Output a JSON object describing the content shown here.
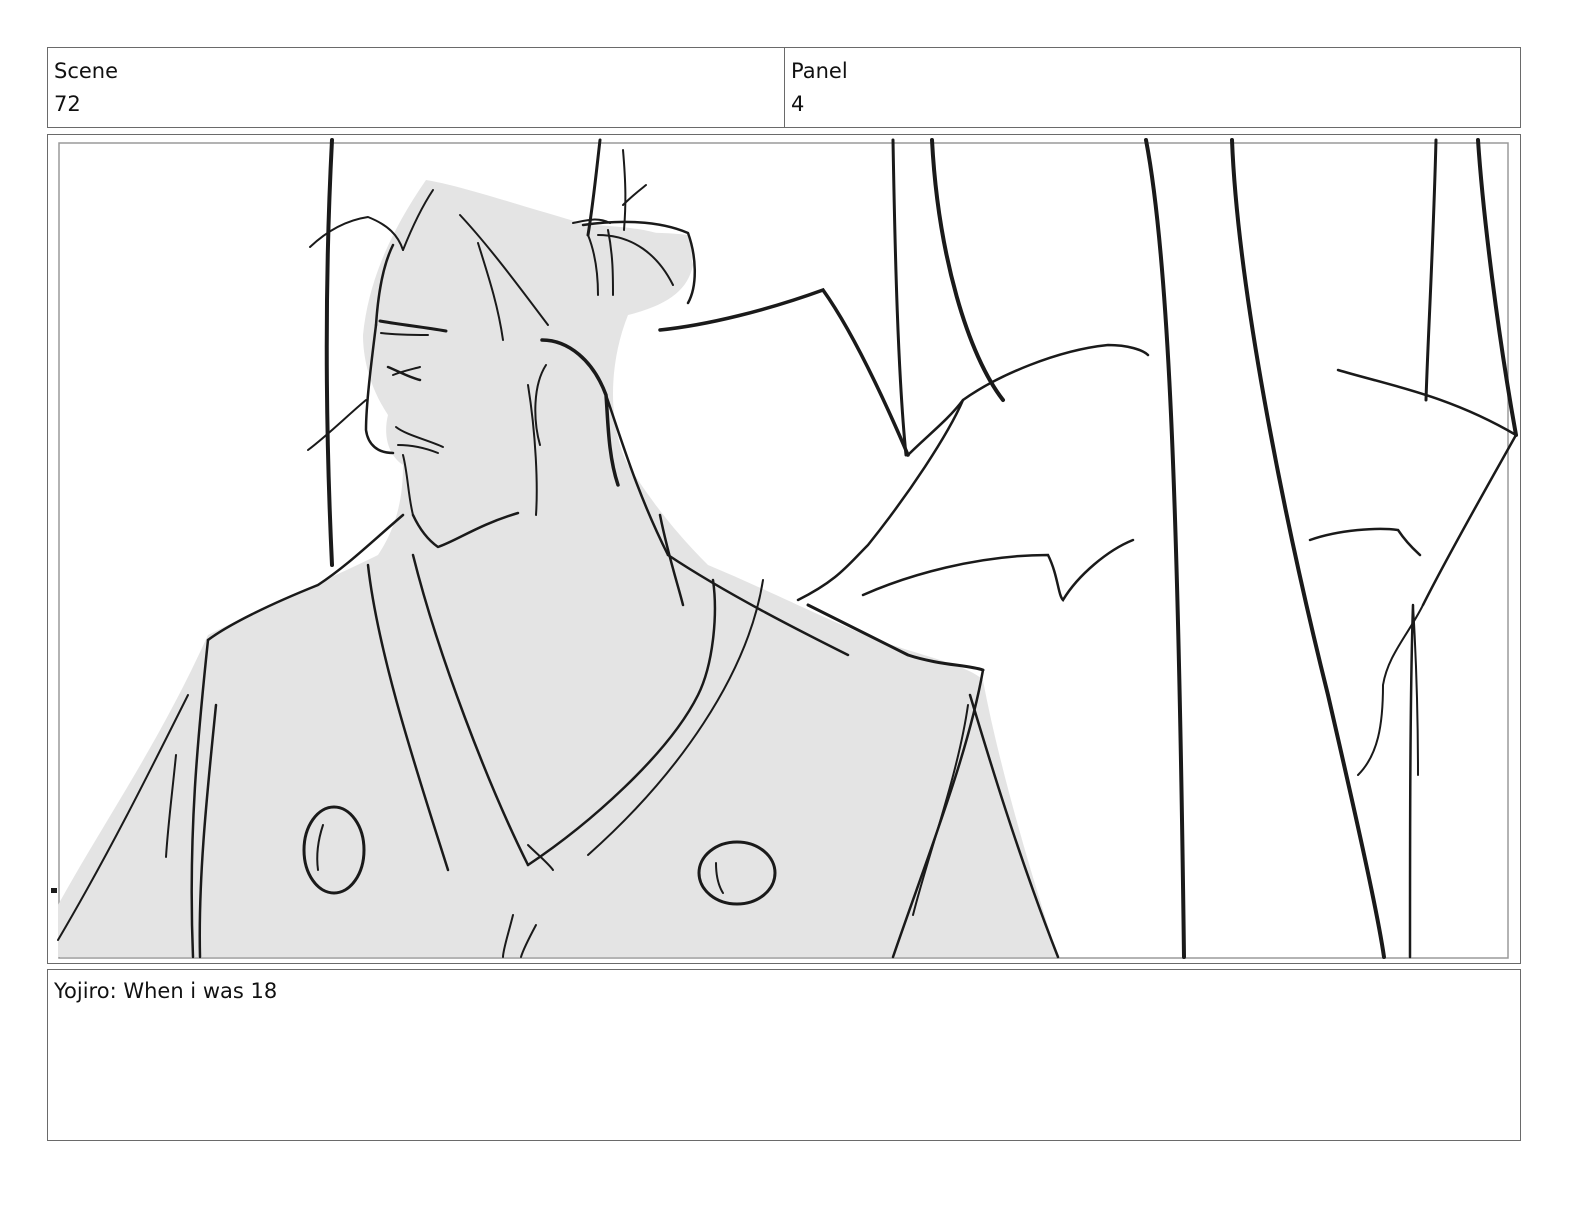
{
  "header": {
    "scene_label": "Scene",
    "scene_value": "72",
    "panel_label": "Panel",
    "panel_value": "4"
  },
  "frame": {
    "illustration": "storyboard sketch",
    "fill_color": "#e4e4e4",
    "line_color": "#1a1a1a"
  },
  "caption": {
    "text": "Yojiro: When i was 18"
  }
}
